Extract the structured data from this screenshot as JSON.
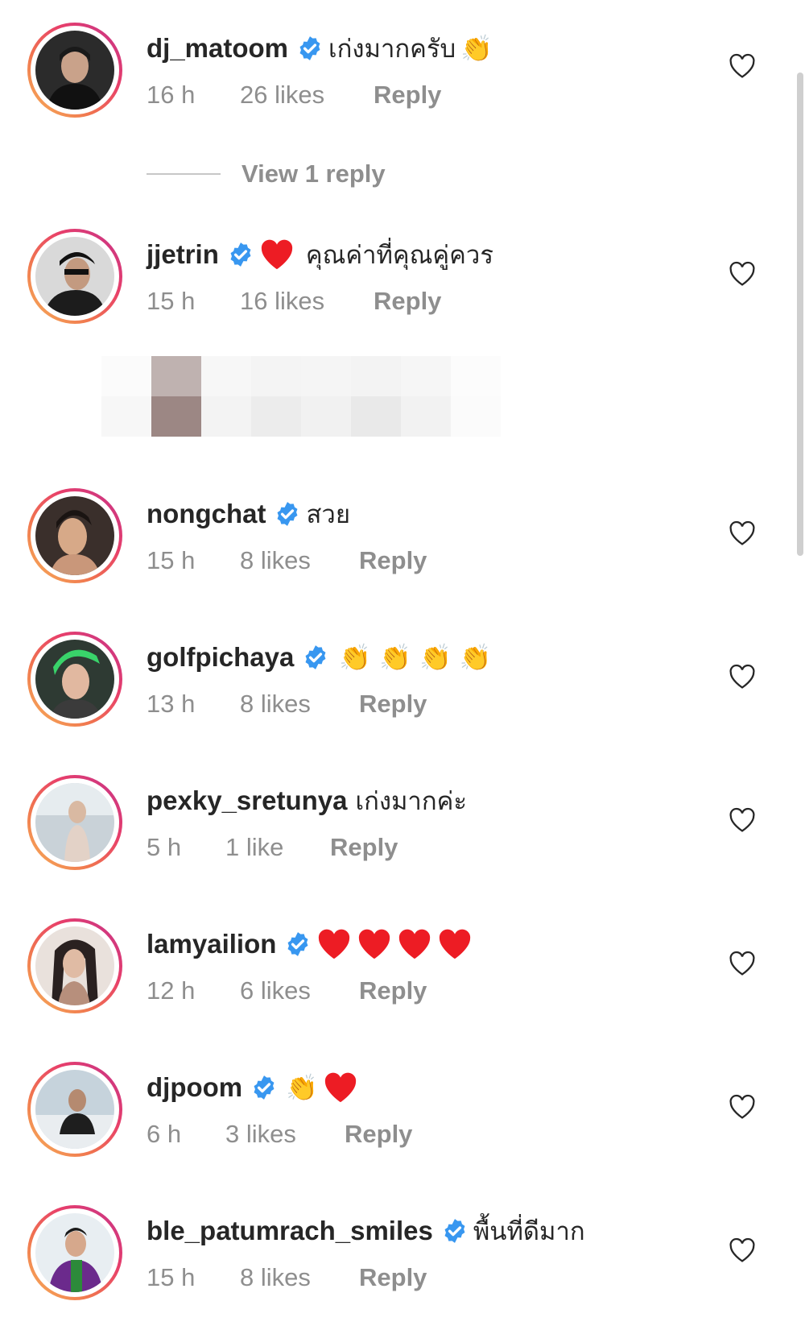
{
  "comments": [
    {
      "username": "dj_matoom",
      "verified": true,
      "text": "เก่งมากครับ",
      "emoji": [
        "clapping-hands"
      ],
      "time": "16 h",
      "likes": "26 likes",
      "reply_label": "Reply",
      "view_replies": "View 1 reply"
    },
    {
      "username": "jjetrin",
      "verified": true,
      "text": "คุณค่าที่คุณคู่ควร",
      "emoji": [
        "red-heart"
      ],
      "time": "15 h",
      "likes": "16 likes",
      "reply_label": "Reply"
    },
    {
      "username": "nongchat",
      "verified": true,
      "text": "สวย",
      "time": "15 h",
      "likes": "8 likes",
      "reply_label": "Reply"
    },
    {
      "username": "golfpichaya",
      "verified": true,
      "emoji": [
        "clapping-hands",
        "clapping-hands",
        "clapping-hands",
        "clapping-hands"
      ],
      "time": "13 h",
      "likes": "8 likes",
      "reply_label": "Reply"
    },
    {
      "username": "pexky_sretunya",
      "verified": false,
      "text": "เก่งมากค่ะ",
      "time": "5 h",
      "likes": "1 like",
      "reply_label": "Reply"
    },
    {
      "username": "lamyailion",
      "verified": true,
      "emoji": [
        "red-heart",
        "red-heart",
        "red-heart",
        "red-heart"
      ],
      "time": "12 h",
      "likes": "6 likes",
      "reply_label": "Reply"
    },
    {
      "username": "djpoom",
      "verified": true,
      "emoji": [
        "clapping-hands",
        "red-heart"
      ],
      "time": "6 h",
      "likes": "3 likes",
      "reply_label": "Reply"
    },
    {
      "username": "ble_patumrach_smiles",
      "verified": true,
      "text": "พื้นที่ดีมาก",
      "time": "15 h",
      "likes": "8 likes",
      "reply_label": "Reply"
    }
  ],
  "colors": {
    "verified_badge": "#3897f0",
    "muted_text": "#8e8e8e",
    "heart_red": "#ed1c24",
    "ring_gradient": [
      "#f7b55a",
      "#f0754f",
      "#e83f6a",
      "#c2338c"
    ]
  },
  "icons": {
    "like_button": "heart-outline-icon",
    "verified": "verified-badge-icon"
  }
}
